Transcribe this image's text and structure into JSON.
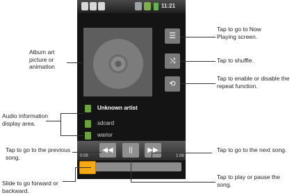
{
  "status_bar": {
    "time": "11:21"
  },
  "info_area": {
    "artist": "Unknown artist",
    "album": "sdcard",
    "title": "warior"
  },
  "playback": {
    "elapsed": "0:09",
    "duration": "1:06",
    "progress_fraction": 0.14
  },
  "controls": {
    "rewind_glyph": "◀◀",
    "pause_glyph": "||",
    "forward_glyph": "▶▶",
    "now_playing_glyph": "☰",
    "shuffle_glyph": "⤨",
    "repeat_glyph": "⟲"
  },
  "callouts": {
    "album_art": "Album art picture or animation",
    "audio_info": "Audio information display area.",
    "previous": "Tap to go to the previous song.",
    "seek": "Slide to go forward or backward.",
    "now_playing": "Tap to go to Now Playing screen.",
    "shuffle": "Tap to shuffle.",
    "repeat": "Tap to enable or disable the repeat function.",
    "next": "Tap to go to the next song.",
    "play_pause": "Tap to play or pause the song."
  }
}
